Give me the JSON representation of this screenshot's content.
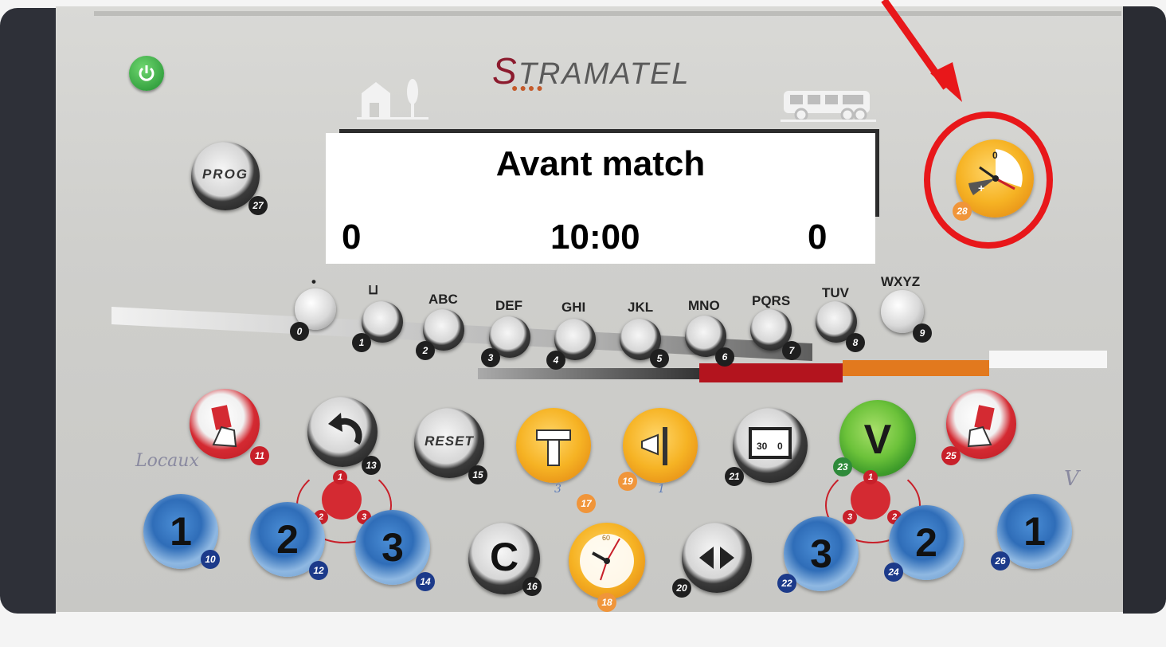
{
  "device": {
    "brand": "STRAMATEL",
    "brand_first": "S",
    "brand_rest": "TRAMATEL"
  },
  "display": {
    "status": "Avant match",
    "home_score": "0",
    "timer": "10:00",
    "away_score": "0"
  },
  "top_buttons": {
    "prog_label": "PROG",
    "prog_badge": "27",
    "period_dial_badge": "28",
    "period_dial_zero": "0"
  },
  "keypad": [
    {
      "letters": "•",
      "badge": "0"
    },
    {
      "letters": "⊔",
      "badge": "1"
    },
    {
      "letters": "ABC",
      "badge": "2"
    },
    {
      "letters": "DEF",
      "badge": "3"
    },
    {
      "letters": "GHI",
      "badge": "4"
    },
    {
      "letters": "JKL",
      "badge": "5"
    },
    {
      "letters": "MNO",
      "badge": "6"
    },
    {
      "letters": "PQRS",
      "badge": "7"
    },
    {
      "letters": "TUV",
      "badge": "8"
    },
    {
      "letters": "WXYZ",
      "badge": "9"
    }
  ],
  "function_row": {
    "red_card_home_badge": "11",
    "undo_badge": "13",
    "reset_label": "RESET",
    "reset_badge": "15",
    "timeout_badge": "17",
    "horn_badge": "19",
    "swap_badge": "21",
    "swap_screen_left": "30",
    "swap_screen_right": "0",
    "validate_label": "V",
    "validate_badge": "23",
    "red_card_away_badge": "25"
  },
  "bottom_row": {
    "home_1_label": "1",
    "home_1_badge": "10",
    "home_2_label": "2",
    "home_2_badge": "12",
    "home_3_label": "3",
    "home_3_badge": "14",
    "clear_label": "C",
    "clear_badge": "16",
    "chrono_badge": "18",
    "chrono_top": "60",
    "arrows_badge": "20",
    "away_3_label": "3",
    "away_3_badge": "22",
    "away_2_label": "2",
    "away_2_badge": "24",
    "away_1_label": "1",
    "away_1_badge": "26"
  },
  "fouls_home": {
    "top": "1",
    "left": "2",
    "right": "3"
  },
  "fouls_away": {
    "top": "1",
    "left": "3",
    "right": "2"
  },
  "handwriting": {
    "home_note": "Locaux",
    "away_note": "V",
    "under_17": "3",
    "under_19": "1"
  },
  "colors": {
    "annotation": "#e8171a",
    "brand_red": "#8c1b2e",
    "lcd_background": "#ffffff"
  }
}
